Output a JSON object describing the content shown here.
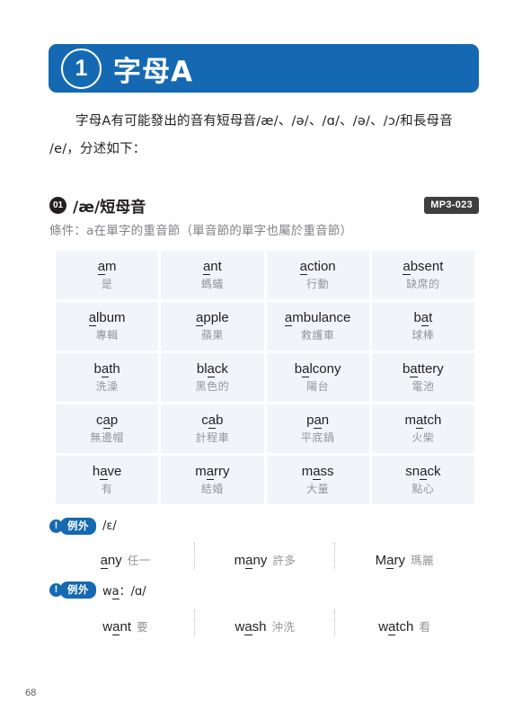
{
  "chapter": {
    "number": "1",
    "title": "字母A"
  },
  "intro": {
    "line1": "字母A有可能發出的音有短母音/æ/、/ə/、/ɑ/、/ə/、/ɔ/和長母音",
    "line2": "/e/，分述如下："
  },
  "section": {
    "number": "01",
    "title": "/æ/短母音",
    "audio_badge": "MP3-023",
    "condition": "條件：a在單字的重音節（單音節的單字也屬於重音節）"
  },
  "word_grid": [
    {
      "pre": "",
      "mark": "a",
      "post": "m",
      "zh": "是"
    },
    {
      "pre": "",
      "mark": "a",
      "post": "nt",
      "zh": "螞蟻"
    },
    {
      "pre": "",
      "mark": "a",
      "post": "ction",
      "zh": "行動"
    },
    {
      "pre": "",
      "mark": "a",
      "post": "bsent",
      "zh": "缺席的"
    },
    {
      "pre": "",
      "mark": "a",
      "post": "lbum",
      "zh": "專輯"
    },
    {
      "pre": "",
      "mark": "a",
      "post": "pple",
      "zh": "蘋果"
    },
    {
      "pre": "",
      "mark": "a",
      "post": "mbulance",
      "zh": "救護車"
    },
    {
      "pre": "b",
      "mark": "a",
      "post": "t",
      "zh": "球棒"
    },
    {
      "pre": "b",
      "mark": "a",
      "post": "th",
      "zh": "洗澡"
    },
    {
      "pre": "bl",
      "mark": "a",
      "post": "ck",
      "zh": "黑色的"
    },
    {
      "pre": "b",
      "mark": "a",
      "post": "lcony",
      "zh": "陽台"
    },
    {
      "pre": "b",
      "mark": "a",
      "post": "ttery",
      "zh": "電池"
    },
    {
      "pre": "c",
      "mark": "a",
      "post": "p",
      "zh": "無邊帽"
    },
    {
      "pre": "c",
      "mark": "a",
      "post": "b",
      "zh": "計程車"
    },
    {
      "pre": "p",
      "mark": "a",
      "post": "n",
      "zh": "平底鍋"
    },
    {
      "pre": "m",
      "mark": "a",
      "post": "tch",
      "zh": "火柴"
    },
    {
      "pre": "h",
      "mark": "a",
      "post": "ve",
      "zh": "有"
    },
    {
      "pre": "m",
      "mark": "a",
      "post": "rry",
      "zh": "結婚"
    },
    {
      "pre": "m",
      "mark": "a",
      "post": "ss",
      "zh": "大量"
    },
    {
      "pre": "sn",
      "mark": "a",
      "post": "ck",
      "zh": "點心"
    }
  ],
  "exceptions": [
    {
      "icon": "!",
      "label": "例外",
      "note_pre": "",
      "note_mark": "",
      "note_post": "",
      "ipa": "/ɛ/",
      "words": [
        {
          "pre": "",
          "mark": "a",
          "post": "ny",
          "zh": "任一"
        },
        {
          "pre": "m",
          "mark": "a",
          "post": "ny",
          "zh": "許多"
        },
        {
          "pre": "M",
          "mark": "a",
          "post": "ry",
          "zh": "瑪麗"
        }
      ]
    },
    {
      "icon": "!",
      "label": "例外",
      "note_pre": "w",
      "note_mark": "a",
      "note_post": "：",
      "ipa": "/ɑ/",
      "words": [
        {
          "pre": "w",
          "mark": "a",
          "post": "nt",
          "zh": "要"
        },
        {
          "pre": "w",
          "mark": "a",
          "post": "sh",
          "zh": "沖洗"
        },
        {
          "pre": "w",
          "mark": "a",
          "post": "tch",
          "zh": "看"
        }
      ]
    }
  ],
  "footer": {
    "page_number": "68"
  },
  "colors": {
    "brand_blue": "#1569b2",
    "cell_bg": "#f1f5fa",
    "muted_text": "#939598",
    "badge_dark": "#3f3f3f"
  }
}
